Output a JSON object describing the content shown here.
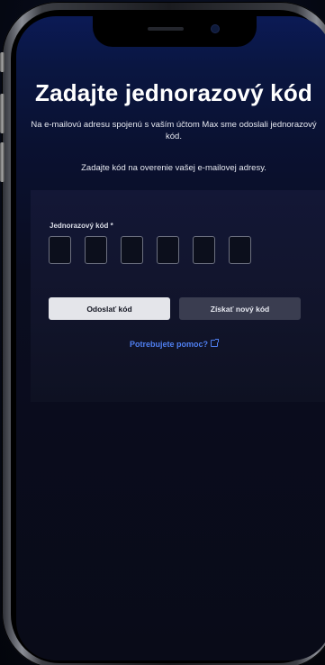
{
  "page": {
    "title": "Zadajte jednorazový kód",
    "description": "Na e-mailovú adresu spojenú s vaším účtom Max sme odoslali jednorazový kód.",
    "instruction": "Zadajte kód na overenie vašej e-mailovej adresy."
  },
  "form": {
    "code_label": "Jednorazový kód *",
    "code_digits": [
      "",
      "",
      "",
      "",
      "",
      ""
    ]
  },
  "buttons": {
    "send_code": "Odoslať kód",
    "get_new_code": "Získať nový kód"
  },
  "help": {
    "label": "Potrebujete pomoc?",
    "icon": "external-link-icon"
  },
  "colors": {
    "accent_link": "#4f7ff0",
    "primary_button": "#e4e5ea",
    "secondary_button": "#3a3d50",
    "background_top": "#0b1a55"
  }
}
